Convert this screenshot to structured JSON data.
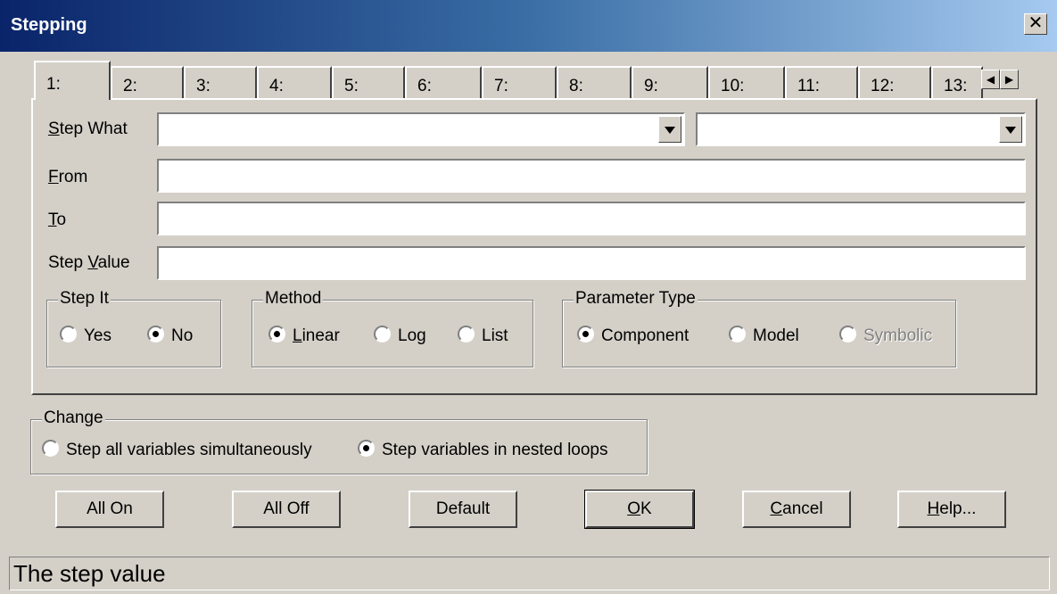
{
  "window": {
    "title": "Stepping",
    "close_label": "✕"
  },
  "tabs": [
    {
      "label": "1:"
    },
    {
      "label": "2:"
    },
    {
      "label": "3:"
    },
    {
      "label": "4:"
    },
    {
      "label": "5:"
    },
    {
      "label": "6:"
    },
    {
      "label": "7:"
    },
    {
      "label": "8:"
    },
    {
      "label": "9:"
    },
    {
      "label": "10:"
    },
    {
      "label": "11:"
    },
    {
      "label": "12:"
    },
    {
      "label": "13:"
    }
  ],
  "tab_scroll": {
    "left": "◀",
    "right": "▶"
  },
  "form": {
    "step_what_label": {
      "mnemonic": "S",
      "rest": "tep What"
    },
    "from_label": {
      "mnemonic": "F",
      "rest": "rom"
    },
    "to_label": {
      "mnemonic": "T",
      "rest": "o"
    },
    "step_value_label": {
      "prefix": "Step ",
      "mnemonic": "V",
      "rest": "alue"
    },
    "step_what_value": "",
    "step_what_secondary_value": "",
    "from_value": "",
    "to_value": "",
    "step_value_value": ""
  },
  "step_it": {
    "legend": "Step It",
    "yes": "Yes",
    "no": "No",
    "selected": "No"
  },
  "method": {
    "legend": "Method",
    "linear_mn": "L",
    "linear_rest": "inear",
    "log_pre": "Lo",
    "log_mn": "g",
    "list": "List",
    "selected": "Linear"
  },
  "parameter_type": {
    "legend": "Parameter Type",
    "component": "Component",
    "model": "Model",
    "symbolic": "Symbolic",
    "selected": "Component"
  },
  "change": {
    "legend": "Change",
    "simultaneous": "Step all variables simultaneously",
    "nested": "Step variables in nested loops",
    "selected": "nested"
  },
  "buttons": {
    "all_on": "All On",
    "all_off": "All Off",
    "default": "Default",
    "ok_mn": "O",
    "ok_rest": "K",
    "cancel_mn": "C",
    "cancel_rest": "ancel",
    "help_mn": "H",
    "help_rest": "elp..."
  },
  "status_text": "The step value"
}
